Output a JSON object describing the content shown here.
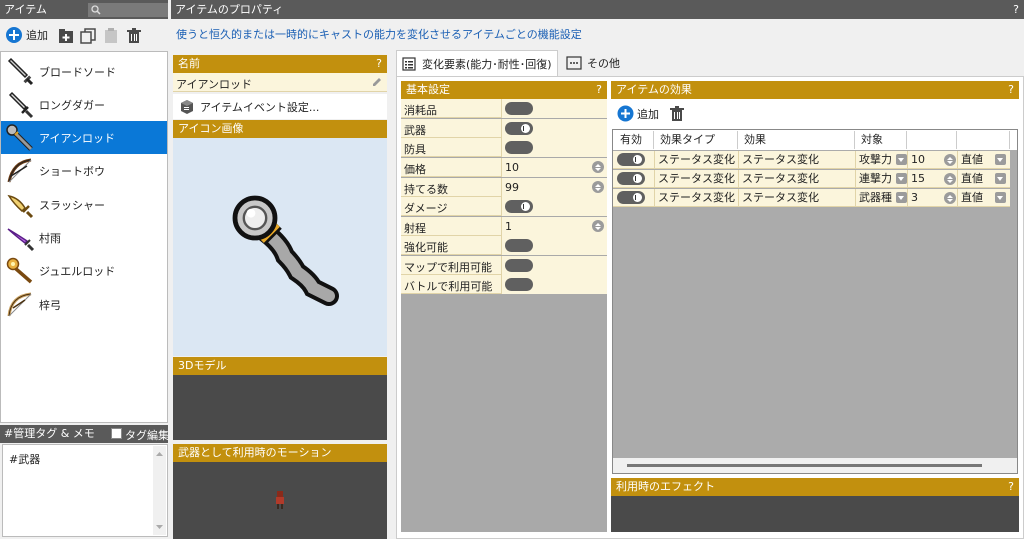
{
  "left_panel": {
    "title": "アイテム",
    "add_label": "追加",
    "items": [
      {
        "label": "ブロードソード",
        "icon": "broadsword-icon"
      },
      {
        "label": "ロングダガー",
        "icon": "long-dagger-icon"
      },
      {
        "label": "アイアンロッド",
        "icon": "iron-rod-icon",
        "selected": true
      },
      {
        "label": "ショートボウ",
        "icon": "short-bow-icon"
      },
      {
        "label": "スラッシャー",
        "icon": "slasher-icon"
      },
      {
        "label": "村雨",
        "icon": "murasame-icon"
      },
      {
        "label": "ジュエルロッド",
        "icon": "jewel-rod-icon"
      },
      {
        "label": "梓弓",
        "icon": "azusa-bow-icon"
      }
    ],
    "tag_header": "#管理タグ & メモ",
    "tag_edit_label": "タグ編集",
    "tag_text": "#武器"
  },
  "properties": {
    "title": "アイテムのプロパティ",
    "help": "?",
    "description": "使うと恒久的または一時的にキャストの能力を変化させるアイテムごとの機能設定"
  },
  "name_section": {
    "header": "名前",
    "value": "アイアンロッド",
    "event_label": "アイテムイベント設定...",
    "icon_header": "アイコン画像",
    "model_header": "3Dモデル",
    "motion_header": "武器として利用時のモーション"
  },
  "tabs": [
    {
      "label": "変化要素(能力･耐性･回復)",
      "active": true
    },
    {
      "label": "その他",
      "active": false
    }
  ],
  "basic": {
    "header": "基本設定",
    "rows": [
      {
        "key": "消耗品",
        "type": "toggle",
        "on": false
      },
      {
        "key": "武器",
        "type": "toggle",
        "on": true
      },
      {
        "key": "防具",
        "type": "toggle",
        "on": false
      },
      {
        "key": "価格",
        "type": "number",
        "value": "10"
      },
      {
        "key": "持てる数",
        "type": "number",
        "value": "99"
      },
      {
        "key": "ダメージ",
        "type": "toggle",
        "on": true
      },
      {
        "key": "射程",
        "type": "number",
        "value": "1"
      },
      {
        "key": "強化可能",
        "type": "toggle",
        "on": false
      },
      {
        "key": "マップで利用可能",
        "type": "toggle",
        "on": false
      },
      {
        "key": "バトルで利用可能",
        "type": "toggle",
        "on": false
      }
    ]
  },
  "effects": {
    "header": "アイテムの効果",
    "add_label": "追加",
    "columns": [
      "有効",
      "効果タイプ",
      "効果",
      "対象"
    ],
    "rows": [
      {
        "type": "ステータス変化",
        "effect": "ステータス変化",
        "target": "攻撃力",
        "value": "10",
        "mode": "直値"
      },
      {
        "type": "ステータス変化",
        "effect": "ステータス変化",
        "target": "連撃力",
        "value": "15",
        "mode": "直値"
      },
      {
        "type": "ステータス変化",
        "effect": "ステータス変化",
        "target": "武器種",
        "value": "3",
        "mode": "直値"
      }
    ],
    "use_effect_header": "利用時のエフェクト"
  }
}
